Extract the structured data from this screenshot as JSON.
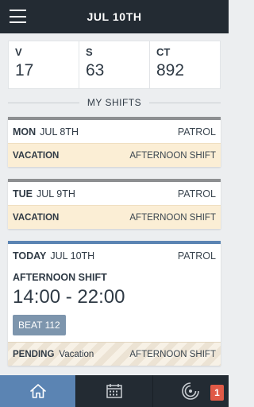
{
  "header": {
    "title": "JUL 10TH"
  },
  "stats": [
    {
      "label": "V",
      "value": "17"
    },
    {
      "label": "S",
      "value": "63"
    },
    {
      "label": "CT",
      "value": "892"
    }
  ],
  "section": {
    "title": "MY SHIFTS"
  },
  "shifts": [
    {
      "day": "MON",
      "date": "JUL 8TH",
      "type": "PATROL",
      "status": "VACATION",
      "shift": "AFTERNOON SHIFT"
    },
    {
      "day": "TUE",
      "date": "JUL 9TH",
      "type": "PATROL",
      "status": "VACATION",
      "shift": "AFTERNOON SHIFT"
    }
  ],
  "today": {
    "day": "TODAY",
    "date": "JUL 10TH",
    "type": "PATROL",
    "shift_title": "AFTERNOON SHIFT",
    "time": "14:00 - 22:00",
    "beat": "BEAT 112",
    "status": "PENDING",
    "status_note": "Vacation",
    "shift": "AFTERNOON SHIFT"
  },
  "nav": {
    "items": [
      {
        "icon": "home-icon",
        "active": true
      },
      {
        "icon": "calendar-icon",
        "active": false
      },
      {
        "icon": "radar-icon",
        "active": false
      }
    ],
    "notification_count": "1"
  },
  "colors": {
    "header_bg": "#232b33",
    "accent": "#5b84b3",
    "vacation_bg": "#fbeed5",
    "badge": "#e05a47"
  }
}
